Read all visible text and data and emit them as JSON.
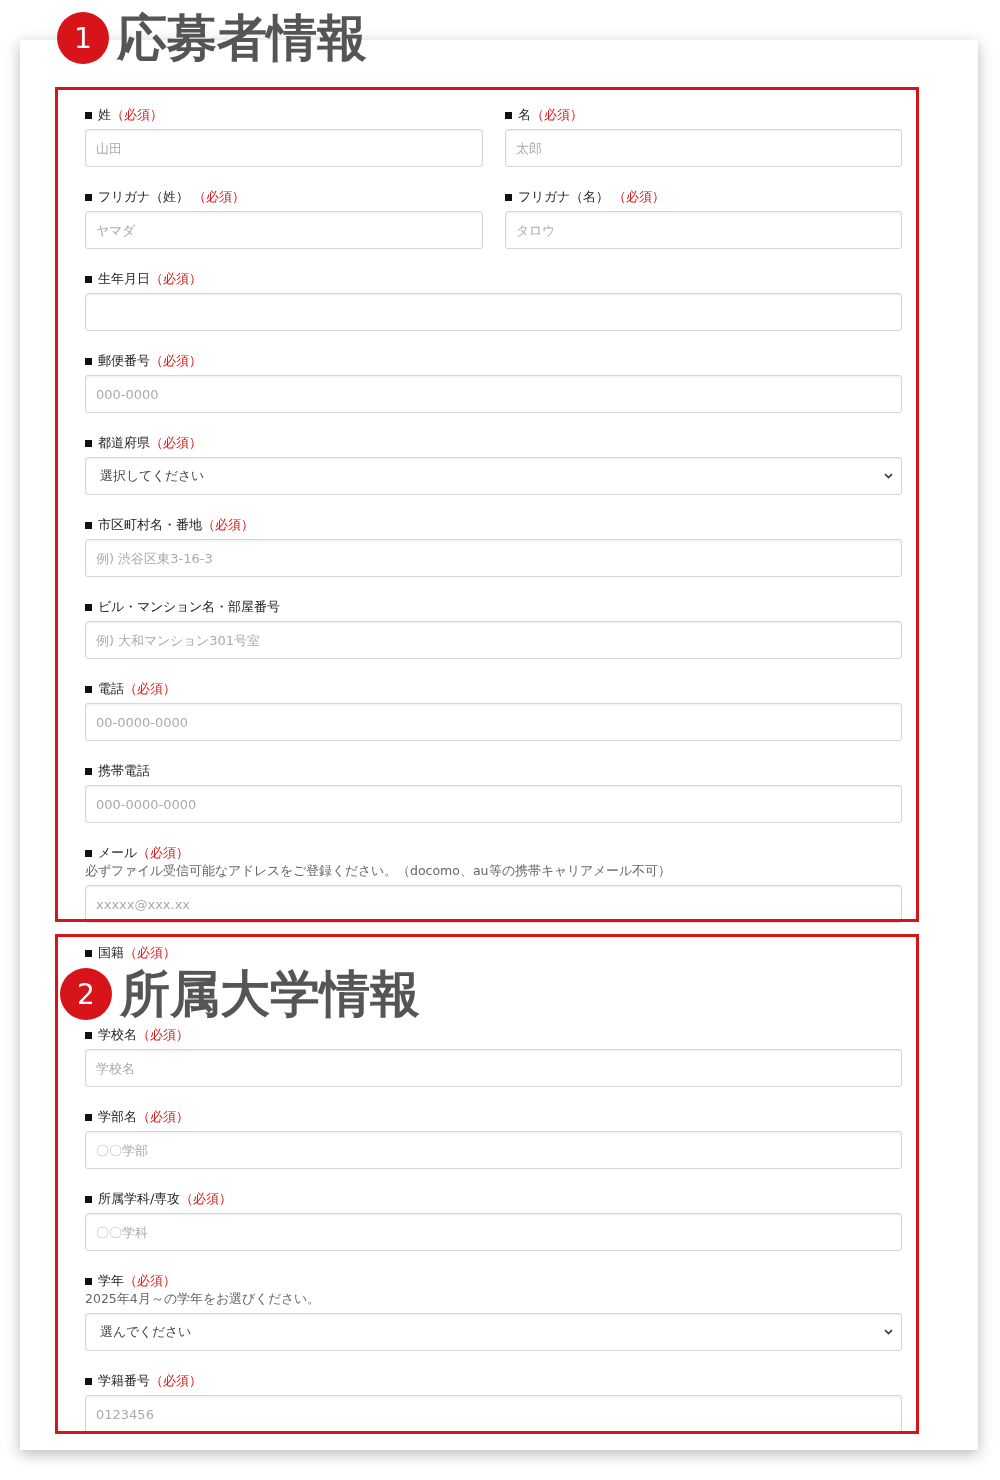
{
  "sections": [
    {
      "number": "1",
      "title": "応募者情報"
    },
    {
      "number": "2",
      "title": "所属大学情報"
    }
  ],
  "form": {
    "rows": [
      {
        "fields": [
          {
            "label": "姓",
            "required_mark": "（必須）",
            "kind": "text",
            "placeholder": "山田"
          },
          {
            "label": "名",
            "required_mark": "（必須）",
            "kind": "text",
            "placeholder": "太郎"
          }
        ]
      },
      {
        "fields": [
          {
            "label": "フリガナ（姓） ",
            "required_mark": "（必須）",
            "kind": "text",
            "placeholder": "ヤマダ"
          },
          {
            "label": "フリガナ（名） ",
            "required_mark": "（必須）",
            "kind": "text",
            "placeholder": "タロウ"
          }
        ]
      },
      {
        "fields": [
          {
            "label": "生年月日",
            "required_mark": "（必須）",
            "kind": "text"
          }
        ]
      },
      {
        "fields": [
          {
            "label": "郵便番号",
            "required_mark": "（必須）",
            "kind": "text",
            "placeholder": "000-0000"
          }
        ]
      },
      {
        "fields": [
          {
            "label": "都道府県",
            "required_mark": "（必須）",
            "kind": "select",
            "value": "選択してください"
          }
        ]
      },
      {
        "fields": [
          {
            "label": "市区町村名・番地",
            "required_mark": "（必須）",
            "kind": "text",
            "placeholder": "例) 渋谷区東3-16-3"
          }
        ]
      },
      {
        "fields": [
          {
            "label": "ビル・マンション名・部屋番号",
            "kind": "text",
            "placeholder": "例) 大和マンション301号室"
          }
        ]
      },
      {
        "fields": [
          {
            "label": "電話",
            "required_mark": "（必須）",
            "kind": "text",
            "placeholder": "00-0000-0000"
          }
        ]
      },
      {
        "fields": [
          {
            "label": "携帯電話",
            "kind": "text",
            "placeholder": "000-0000-0000"
          }
        ]
      },
      {
        "fields": [
          {
            "label": "メール",
            "required_mark": "（必須）",
            "note": "必ずファイル受信可能なアドレスをご登録ください。（docomo、au等の携帯キャリアメール不可）",
            "kind": "text",
            "placeholder": "xxxxx@xxx.xx"
          }
        ]
      },
      {
        "fields": [
          {
            "label": "国籍",
            "required_mark": "（必須）"
          }
        ]
      },
      {
        "fields": [
          {
            "label": "学校名",
            "required_mark": "（必須）",
            "kind": "text",
            "placeholder": "学校名"
          }
        ]
      },
      {
        "fields": [
          {
            "label": "学部名",
            "required_mark": "（必須）",
            "kind": "text",
            "placeholder": "〇〇学部"
          }
        ]
      },
      {
        "fields": [
          {
            "label": "所属学科/専攻",
            "required_mark": "（必須）",
            "kind": "text",
            "placeholder": "〇〇学科"
          }
        ]
      },
      {
        "fields": [
          {
            "label": "学年",
            "required_mark": "（必須）",
            "note": "2025年4月～の学年をお選びください。",
            "kind": "select",
            "value": "選んでください"
          }
        ]
      },
      {
        "fields": [
          {
            "label": "学籍番号",
            "required_mark": "（必須）",
            "kind": "text",
            "placeholder": "0123456"
          }
        ]
      }
    ]
  }
}
